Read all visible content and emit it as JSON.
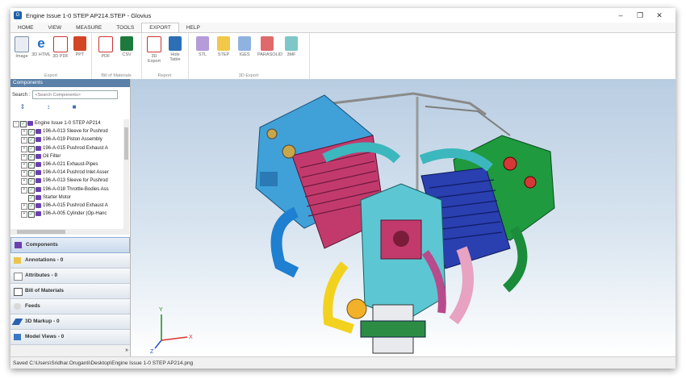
{
  "window": {
    "title": "Engine Issue 1-0 STEP AP214.STEP - Glovius",
    "controls": [
      "minimize",
      "restore",
      "close"
    ]
  },
  "ribbon": {
    "tabs": [
      "HOME",
      "VIEW",
      "MEASURE",
      "TOOLS",
      "EXPORT",
      "HELP"
    ],
    "active_tab": "EXPORT",
    "groups": [
      {
        "label": "Export",
        "buttons": [
          {
            "label": "Image",
            "icon": "image-icon"
          },
          {
            "label": "3D HTML",
            "icon": "html-icon"
          },
          {
            "label": "3D PDF",
            "icon": "pdf-icon"
          },
          {
            "label": "PPT",
            "icon": "ppt-icon"
          }
        ]
      },
      {
        "label": "Bill of Materials",
        "buttons": [
          {
            "label": "PDF",
            "icon": "pdf-icon"
          },
          {
            "label": "CSV",
            "icon": "csv-icon"
          }
        ]
      },
      {
        "label": "Report",
        "buttons": [
          {
            "label": "3D Export",
            "icon": "report-icon"
          },
          {
            "label": "Hole Table",
            "icon": "hole-table-icon"
          }
        ]
      },
      {
        "label": "3D Export",
        "buttons": [
          {
            "label": "STL",
            "icon": "stl-icon"
          },
          {
            "label": "STEP",
            "icon": "step-icon"
          },
          {
            "label": "IGES",
            "icon": "iges-icon"
          },
          {
            "label": "PARASOLID",
            "icon": "parasolid-icon"
          },
          {
            "label": "3MF",
            "icon": "3mf-icon"
          }
        ]
      }
    ]
  },
  "components_panel": {
    "header": "Components",
    "search_label": "Search :",
    "search_placeholder": "<Search Components>",
    "tree": [
      {
        "label": "Engine Issue 1-0 STEP AP214",
        "level": 0
      },
      {
        "label": "196-A-013 Sleeve for Pushrod",
        "level": 1
      },
      {
        "label": "196-A-019 Piston Assembly",
        "level": 1
      },
      {
        "label": "196-A-015 Pushrod Exhaust A",
        "level": 1
      },
      {
        "label": "Oil Filter",
        "level": 1
      },
      {
        "label": "196-A-021 Exhaust-Pipes",
        "level": 1
      },
      {
        "label": "196-A-014 Pushrod Inlet Asser",
        "level": 1
      },
      {
        "label": "196-A-013 Sleeve for Pushrod",
        "level": 1
      },
      {
        "label": "196-A-018 Throttle-Bodies Ass",
        "level": 1
      },
      {
        "label": "Starter Motor",
        "level": 1
      },
      {
        "label": "196-A-015 Pushrod Exhaust A",
        "level": 1
      },
      {
        "label": "196-A-005 Cylinder (Op-Hanc",
        "level": 1
      }
    ],
    "sections": [
      {
        "label": "Components",
        "icon": "components-icon",
        "active": true
      },
      {
        "label": "Annotations - 0",
        "icon": "annotations-icon",
        "active": false
      },
      {
        "label": "Attributes - 0",
        "icon": "attributes-icon",
        "active": false
      },
      {
        "label": "Bill of Materials",
        "icon": "bom-icon",
        "active": false
      },
      {
        "label": "Feeds",
        "icon": "feeds-icon",
        "active": false
      },
      {
        "label": "3D Markup - 0",
        "icon": "markup-icon",
        "active": false
      },
      {
        "label": "Model Views - 0",
        "icon": "model-views-icon",
        "active": false
      }
    ]
  },
  "viewport": {
    "axis_labels": {
      "x": "X",
      "y": "Y",
      "z": "Z"
    }
  },
  "status_bar": {
    "text": "Saved C:\\Users\\Sridhar.Oruganti\\Desktop\\Engine Issue 1-0 STEP AP214.png"
  }
}
